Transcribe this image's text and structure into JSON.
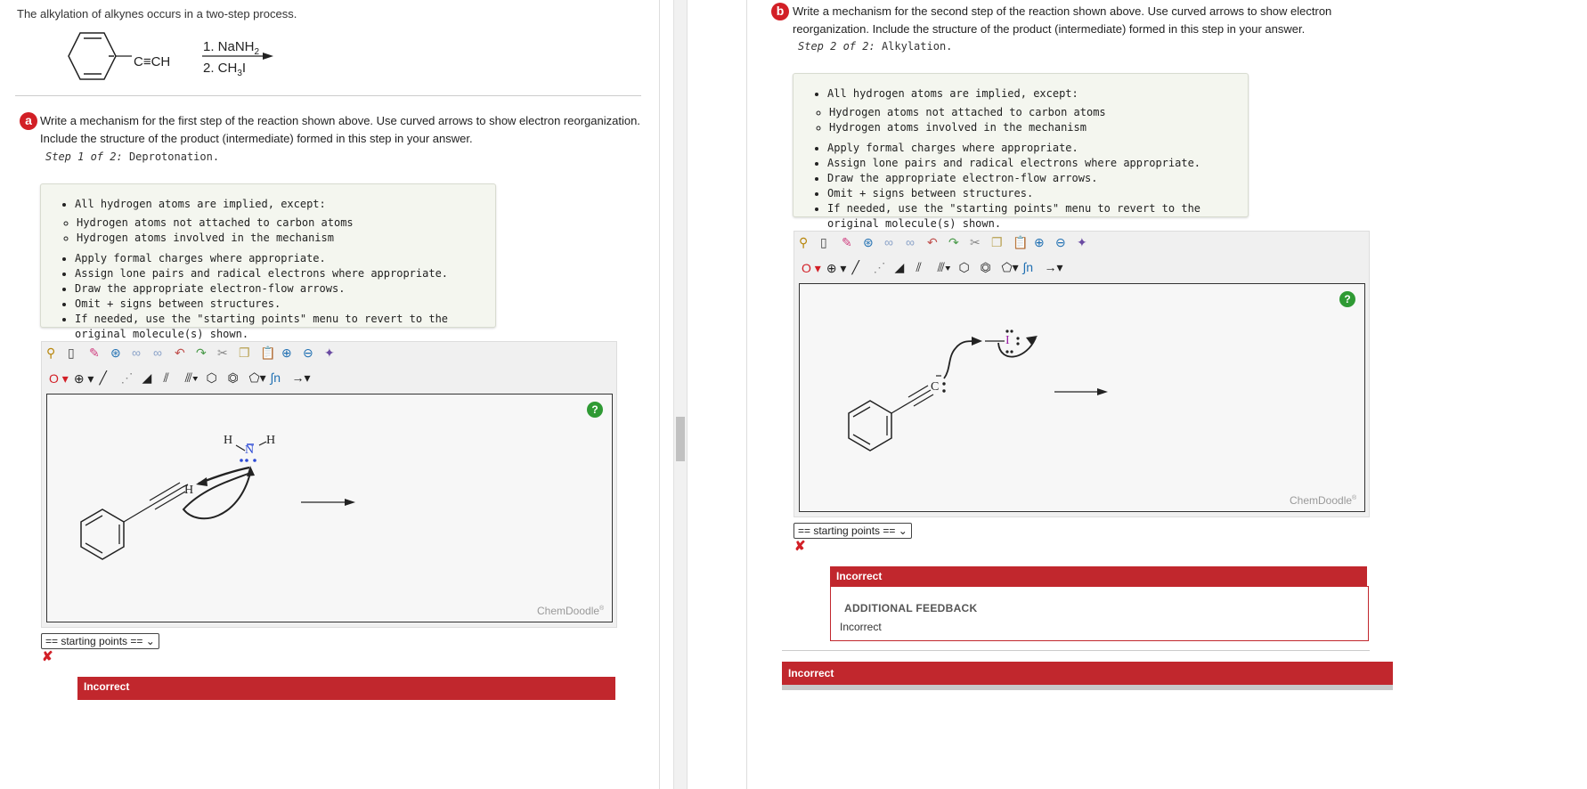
{
  "intro": "The alkylation of alkynes occurs in a two-step process.",
  "reaction": {
    "alkyne_group": "C≡CH",
    "reagent1": "1. NaNH",
    "reagent1_sub": "2",
    "reagent2": "2. CH",
    "reagent2_sub": "3",
    "reagent2_tail": "I"
  },
  "part_a": {
    "badge": "a",
    "question": "Write a mechanism for the first step of the reaction shown above. Use curved arrows to show electron reorganization. Include the structure of the product (intermediate) formed in this step in your answer.",
    "step_prefix": "Step 1 of 2:",
    "step_name": "Deprotonation.",
    "starting_points": "== starting points ==",
    "incorrect": "Incorrect"
  },
  "part_b": {
    "badge": "b",
    "question": "Write a mechanism for the second step of the reaction shown above. Use curved arrows to show electron reorganization. Include the structure of the product (intermediate) formed in this step in your answer.",
    "step_prefix": "Step 2 of 2:",
    "step_name": "Alkylation.",
    "starting_points": "== starting points ==",
    "incorrect": "Incorrect",
    "additional_feedback": "ADDITIONAL FEEDBACK",
    "feedback_text": "Incorrect",
    "incorrect2": "Incorrect"
  },
  "instructions": {
    "item1": "All hydrogen atoms are implied, except:",
    "sub1": "Hydrogen atoms not attached to carbon atoms",
    "sub2": "Hydrogen atoms involved in the mechanism",
    "item2": "Apply formal charges where appropriate.",
    "item3": "Assign lone pairs and radical electrons where appropriate.",
    "item4": "Draw the appropriate electron-flow arrows.",
    "item5": "Omit + signs between structures.",
    "item6": "If needed, use the \"starting points\" menu to revert to the original molecule(s) shown."
  },
  "editor": {
    "logo": "ChemDoodle",
    "help": "?",
    "atom_label": "O",
    "charge_label": "⊕",
    "toolbar_icons": [
      "lasso-icon",
      "eraser-bottle-icon",
      "eraser-icon",
      "ring-template-icon",
      "rings-icon",
      "molecule-icon",
      "undo-icon",
      "redo-icon",
      "scissors-icon",
      "copy-icon",
      "paste-icon",
      "zoom-in-icon",
      "zoom-out-icon",
      "clean-icon"
    ],
    "bond_tools": [
      "single-bond-icon",
      "dashed-bond-icon",
      "wedge-bond-icon",
      "double-bond-icon",
      "triple-bond-icon",
      "hexagon-icon",
      "benzene-icon",
      "pentagon-icon",
      "chain-icon",
      "arrow-icon"
    ]
  },
  "drawing_a": {
    "h_left": "H",
    "n": "N",
    "h_right": "H",
    "h_alkyne": "H"
  },
  "drawing_b": {
    "c": "C",
    "i": "I"
  },
  "colors": {
    "accent_red": "#c1272d",
    "badge_red": "#d21f26",
    "help_green": "#2f9a34",
    "nitrogen_blue": "#2d4bd6",
    "iodine_purple": "#9b1fa5"
  }
}
